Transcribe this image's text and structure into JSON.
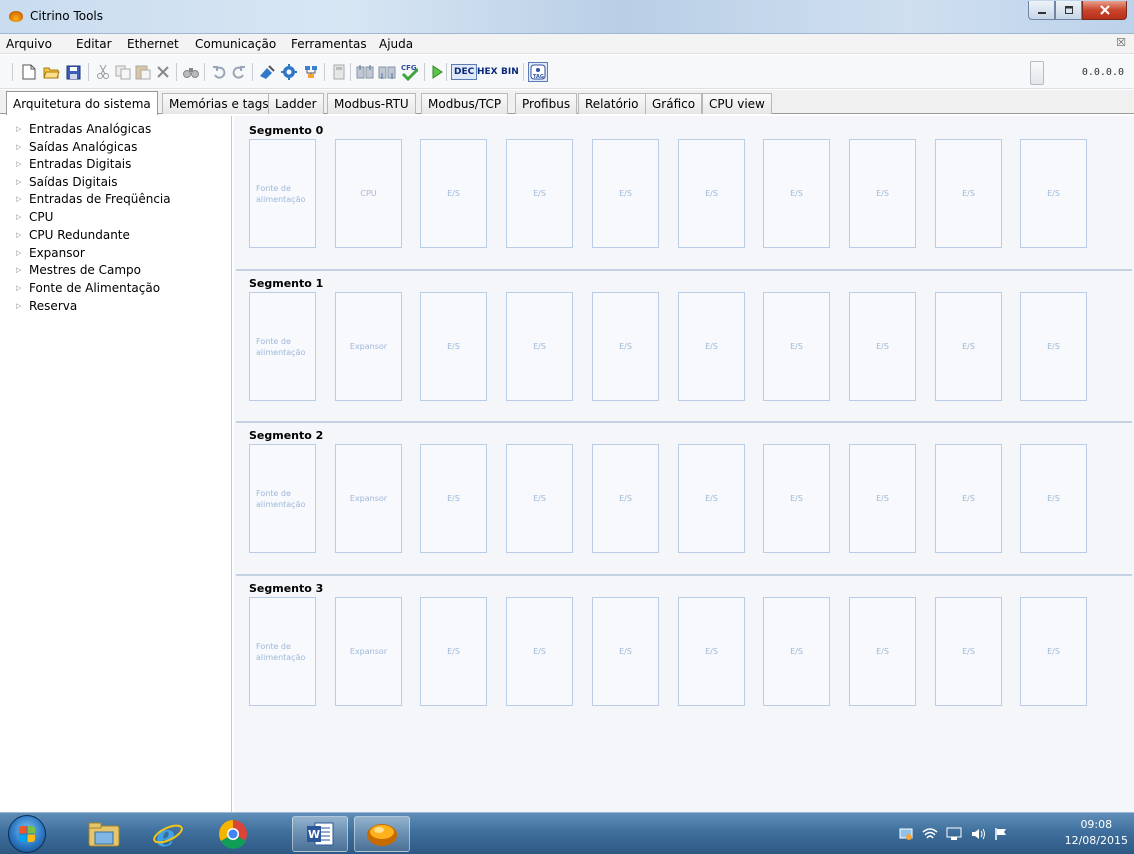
{
  "window": {
    "title": "Citrino Tools",
    "minimize_icon": "minimize-icon",
    "maximize_icon": "maximize-icon",
    "close_icon": "close-icon"
  },
  "menu": {
    "items": [
      "Arquivo",
      "Editar",
      "Ethernet",
      "Comunicação",
      "Ferramentas",
      "Ajuda"
    ],
    "mdi_close": "☒"
  },
  "toolbar": {
    "icons": [
      "new-file-icon",
      "open-folder-icon",
      "save-icon",
      "cut-icon",
      "copy-icon",
      "paste-icon",
      "delete-icon",
      "find-icon",
      "undo-icon",
      "redo-icon",
      "connect-icon",
      "settings-gear-icon",
      "network-icon",
      "compile-icon",
      "upload-icon",
      "download-icon",
      "cfg-check-icon",
      "run-icon",
      "tag-icon"
    ],
    "dec_label": "DEC",
    "hex_label": "HEX",
    "bin_label": "BIN",
    "ip_address": "0.0.0.0"
  },
  "tabs": [
    {
      "label": "Arquitetura do sistema",
      "active": true
    },
    {
      "label": "Memórias e tags",
      "active": false
    },
    {
      "label": "Ladder",
      "active": false
    },
    {
      "label": "Modbus-RTU",
      "active": false
    },
    {
      "label": "Modbus/TCP",
      "active": false
    },
    {
      "label": "Profibus",
      "active": false
    },
    {
      "label": "Relatório",
      "active": false
    },
    {
      "label": "Gráfico",
      "active": false
    },
    {
      "label": "CPU view",
      "active": false
    }
  ],
  "tree": {
    "items": [
      "Entradas Analógicas",
      "Saídas Analógicas",
      "Entradas Digitais",
      "Saídas Digitais",
      "Entradas de Freqüência",
      "CPU",
      "CPU Redundante",
      "Expansor",
      "Mestres de Campo",
      "Fonte de Alimentação",
      "Reserva"
    ]
  },
  "segments": [
    {
      "title": "Segmento 0",
      "slots": [
        "Fonte de alimentação",
        "CPU",
        "E/S",
        "E/S",
        "E/S",
        "E/S",
        "E/S",
        "E/S",
        "E/S",
        "E/S"
      ]
    },
    {
      "title": "Segmento 1",
      "slots": [
        "Fonte de alimentação",
        "Expansor",
        "E/S",
        "E/S",
        "E/S",
        "E/S",
        "E/S",
        "E/S",
        "E/S",
        "E/S"
      ]
    },
    {
      "title": "Segmento 2",
      "slots": [
        "Fonte de alimentação",
        "Expansor",
        "E/S",
        "E/S",
        "E/S",
        "E/S",
        "E/S",
        "E/S",
        "E/S",
        "E/S"
      ]
    },
    {
      "title": "Segmento 3",
      "slots": [
        "Fonte de alimentação",
        "Expansor",
        "E/S",
        "E/S",
        "E/S",
        "E/S",
        "E/S",
        "E/S",
        "E/S",
        "E/S"
      ]
    }
  ],
  "taskbar": {
    "apps": [
      "file-explorer-icon",
      "internet-explorer-icon",
      "chrome-icon",
      "word-icon",
      "citrino-tools-icon"
    ],
    "time": "09:08",
    "date": "12/08/2015"
  }
}
